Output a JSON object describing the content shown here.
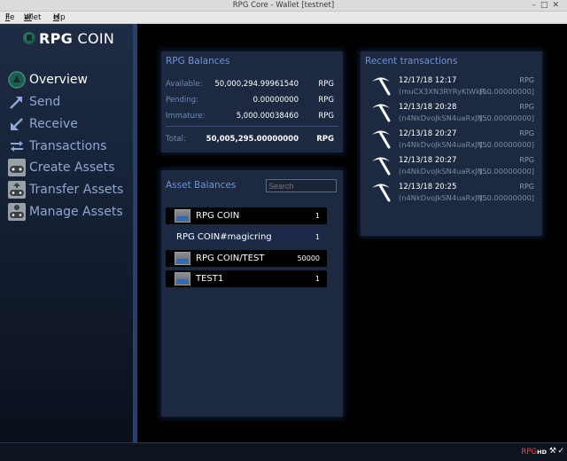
{
  "window": {
    "title": "RPG Core - Wallet [testnet]"
  },
  "menu": [
    {
      "label": "File",
      "u": "F",
      "rest": "ile"
    },
    {
      "label": "Wallet",
      "u": "W",
      "rest": "allet"
    },
    {
      "label": "Help",
      "u": "H",
      "rest": "elp"
    }
  ],
  "logo": {
    "bold": "RPG",
    "rest": " COIN"
  },
  "nav": [
    {
      "label": "Overview",
      "icon": "overview-icon",
      "active": true
    },
    {
      "label": "Send",
      "icon": "send-arrow-icon"
    },
    {
      "label": "Receive",
      "icon": "receive-arrow-icon"
    },
    {
      "label": "Transactions",
      "icon": "transactions-icon"
    },
    {
      "label": "Create Assets",
      "icon": "gamepad-icon"
    },
    {
      "label": "Transfer Assets",
      "icon": "transfer-gamepad-icon"
    },
    {
      "label": "Manage Assets",
      "icon": "manage-gamepad-icon"
    }
  ],
  "balances": {
    "title": "RPG Balances",
    "rows": [
      {
        "label": "Available:",
        "value": "50,000,294.99961540",
        "unit": "RPG"
      },
      {
        "label": "Pending:",
        "value": "0.00000000",
        "unit": "RPG"
      },
      {
        "label": "Immature:",
        "value": "5,000.00038460",
        "unit": "RPG"
      }
    ],
    "total": {
      "label": "Total:",
      "value": "50,005,295.00000000",
      "unit": "RPG"
    }
  },
  "assets": {
    "title": "Asset Balances",
    "search_placeholder": "Search",
    "items": [
      {
        "name": "RPG  COIN",
        "amount": "1",
        "has_icon": true,
        "selected": false
      },
      {
        "name": "RPG  COIN#magicring",
        "amount": "1",
        "has_icon": false,
        "selected": true
      },
      {
        "name": "RPG  COIN/TEST",
        "amount": "50000",
        "has_icon": true,
        "selected": false
      },
      {
        "name": "TEST1",
        "amount": "1",
        "has_icon": true,
        "selected": false
      }
    ]
  },
  "transactions": {
    "title": "Recent transactions",
    "items": [
      {
        "date": "12/17/18 12:17",
        "currency": "RPG",
        "address": "(muCX3XN3RYRyKIWkR...",
        "amount": "[50.00000000]"
      },
      {
        "date": "12/13/18 20:28",
        "currency": "RPG",
        "address": "(n4NkDvoJkSN4uaRxJN...",
        "amount": "[50.00000000]"
      },
      {
        "date": "12/13/18 20:27",
        "currency": "RPG",
        "address": "(n4NkDvoJkSN4uaRxJN...",
        "amount": "[50.00000000]"
      },
      {
        "date": "12/13/18 20:27",
        "currency": "RPG",
        "address": "(n4NkDvoJkSN4uaRxJN...",
        "amount": "[50.00000000]"
      },
      {
        "date": "12/13/18 20:25",
        "currency": "RPG",
        "address": "(n4NkDvoJkSN4uaRxJN...",
        "amount": "[50.00000000]"
      }
    ]
  },
  "status": {
    "unit": "RPG",
    "hd": "HD"
  },
  "colors": {
    "accent": "#6f93d4",
    "panel": "#1c2940",
    "unit_status": "#e04848"
  }
}
